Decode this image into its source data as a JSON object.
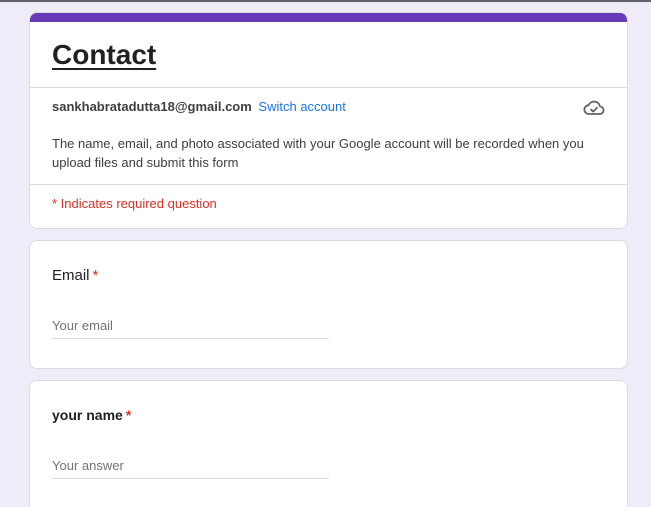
{
  "theme": {
    "accent": "#673ab7",
    "required": "#d93025",
    "link": "#1a73e8",
    "background": "#f0ebf8"
  },
  "form": {
    "title": "Contact",
    "account_email": "sankhabratadutta18@gmail.com",
    "switch_account": "Switch account",
    "cloud_icon": "cloud-check-icon",
    "notice": "The name, email, and photo associated with your Google account will be recorded when you upload files and submit this form",
    "required_note": "* Indicates required question"
  },
  "questions": [
    {
      "label": "Email",
      "required_mark": "*",
      "placeholder": "Your email",
      "value": ""
    },
    {
      "label": "your name",
      "required_mark": "*",
      "placeholder": "Your answer",
      "value": ""
    }
  ]
}
